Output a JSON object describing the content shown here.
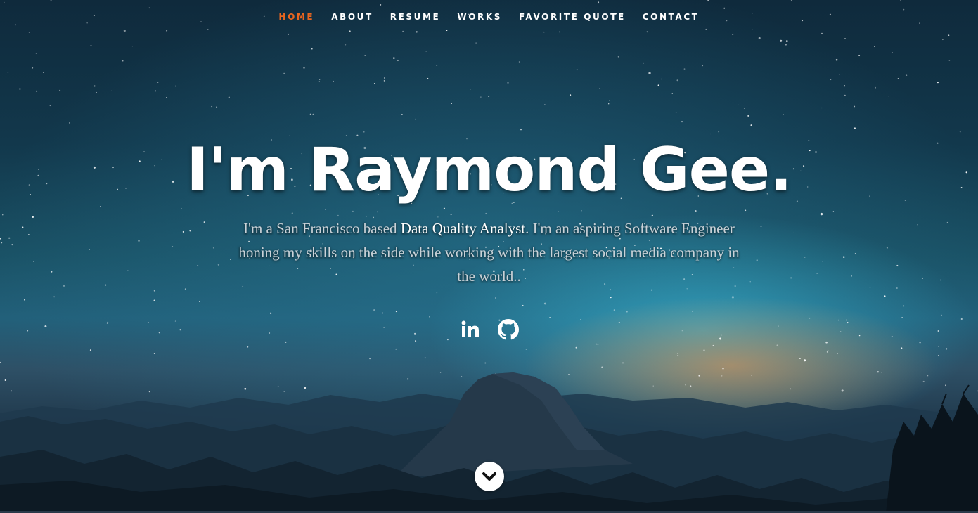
{
  "nav": {
    "items": [
      "HOME",
      "ABOUT",
      "RESUME",
      "WORKS",
      "FAVORITE QUOTE",
      "CONTACT"
    ],
    "active": "HOME",
    "active_color": "#e8651f"
  },
  "banner": {
    "headline": "I'm Raymond Gee.",
    "bio_before": "I'm a San Francisco based ",
    "bio_highlight": "Data Quality Analyst",
    "bio_after": ". I'm an aspiring Software Engineer honing my skills on the side while working with the largest social media company in the world.."
  },
  "social": {
    "icons": [
      "linkedin-icon",
      "github-icon"
    ]
  },
  "scroll": {
    "icon": "chevron-down-icon"
  }
}
